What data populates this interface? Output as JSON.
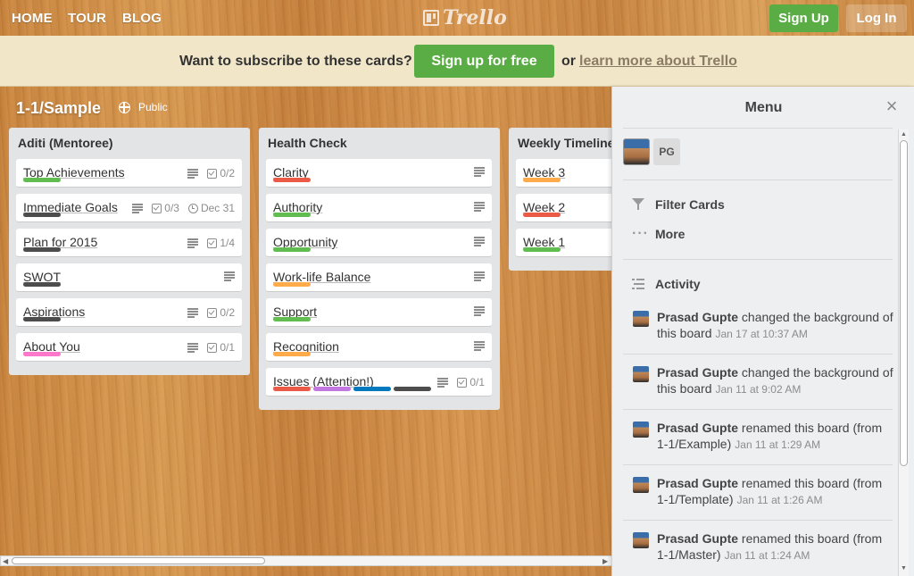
{
  "nav": {
    "home": "HOME",
    "tour": "TOUR",
    "blog": "BLOG",
    "logo_text": "Trello",
    "signup": "Sign Up",
    "login": "Log In"
  },
  "promo": {
    "question": "Want to subscribe to these cards?",
    "signup_button": "Sign up for free",
    "or": "or",
    "learn_link": "learn more about Trello"
  },
  "board": {
    "title": "1-1/Sample",
    "visibility": "Public"
  },
  "lists": [
    {
      "title": "Aditi (Mentoree)",
      "cards": [
        {
          "title": "Top Achievements",
          "labels": [
            "#61bd4f"
          ],
          "desc": true,
          "checklist": "0/2"
        },
        {
          "title": "Immediate Goals",
          "labels": [
            "#4d4d4d"
          ],
          "desc": true,
          "checklist": "0/3",
          "due": "Dec 31"
        },
        {
          "title": "Plan for 2015",
          "labels": [
            "#4d4d4d"
          ],
          "desc": true,
          "checklist": "1/4"
        },
        {
          "title": "SWOT",
          "labels": [
            "#4d4d4d"
          ],
          "desc": true
        },
        {
          "title": "Aspirations",
          "labels": [
            "#4d4d4d"
          ],
          "desc": true,
          "checklist": "0/2"
        },
        {
          "title": "About You",
          "labels": [
            "#ff78cb"
          ],
          "desc": true,
          "checklist": "0/1"
        }
      ]
    },
    {
      "title": "Health Check",
      "cards": [
        {
          "title": "Clarity",
          "labels": [
            "#eb5a46"
          ],
          "desc": true
        },
        {
          "title": "Authority",
          "labels": [
            "#61bd4f"
          ],
          "desc": true
        },
        {
          "title": "Opportunity",
          "labels": [
            "#61bd4f"
          ],
          "desc": true
        },
        {
          "title": "Work-life Balance",
          "labels": [
            "#ffab4a"
          ],
          "desc": true
        },
        {
          "title": "Support",
          "labels": [
            "#61bd4f"
          ],
          "desc": true
        },
        {
          "title": "Recognition",
          "labels": [
            "#ffab4a"
          ],
          "desc": true
        },
        {
          "title": "Issues (Attention!)",
          "labels": [
            "#eb5a46",
            "#c377e0",
            "#0079bf",
            "#4d4d4d"
          ],
          "desc": true,
          "checklist": "0/1"
        }
      ]
    },
    {
      "title": "Weekly Timeline",
      "cards": [
        {
          "title": "Week 3",
          "labels": [
            "#ffab4a"
          ]
        },
        {
          "title": "Week 2",
          "labels": [
            "#eb5a46"
          ]
        },
        {
          "title": "Week 1",
          "labels": [
            "#61bd4f"
          ]
        }
      ]
    }
  ],
  "menu": {
    "title": "Menu",
    "member_initials": "PG",
    "filter_cards": "Filter Cards",
    "more": "More",
    "activity_heading": "Activity",
    "activities": [
      {
        "name": "Prasad Gupte",
        "action": "changed the background of this board",
        "date": "Jan 17 at 10:37 AM"
      },
      {
        "name": "Prasad Gupte",
        "action": "changed the background of this board",
        "date": "Jan 11 at 9:02 AM"
      },
      {
        "name": "Prasad Gupte",
        "action": "renamed this board (from 1-1/Example)",
        "date": "Jan 11 at 1:29 AM"
      },
      {
        "name": "Prasad Gupte",
        "action": "renamed this board (from 1-1/Template)",
        "date": "Jan 11 at 1:26 AM"
      },
      {
        "name": "Prasad Gupte",
        "action": "renamed this board (from 1-1/Master)",
        "date": "Jan 11 at 1:24 AM"
      }
    ]
  }
}
